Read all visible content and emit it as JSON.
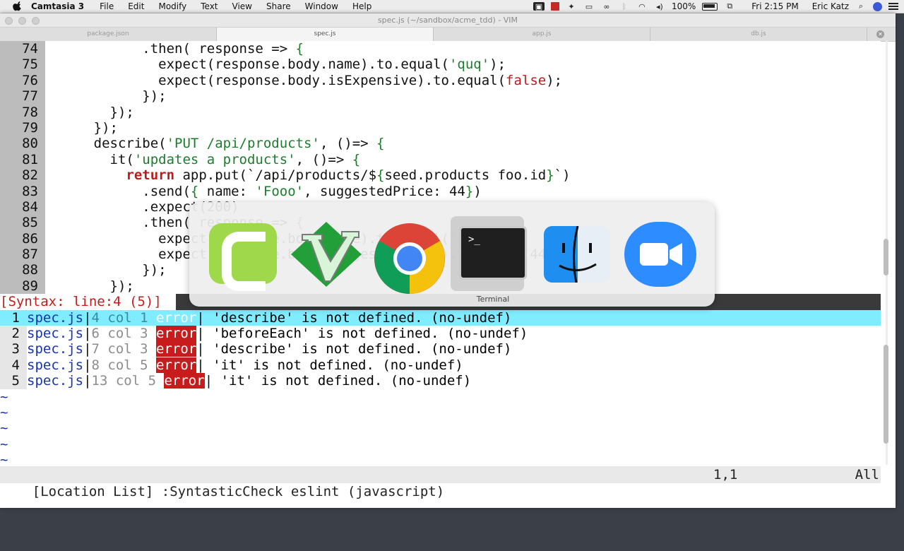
{
  "menubar": {
    "app_name": "Camtasia 3",
    "menus": [
      "File",
      "Edit",
      "Modify",
      "Text",
      "View",
      "Share",
      "Window",
      "Help"
    ],
    "battery": "100%",
    "clock": "Fri 2:15 PM",
    "user": "Eric Katz"
  },
  "window": {
    "title": "spec.js (~/sandbox/acme_tdd) - VIM",
    "tabs": [
      "package.json",
      "spec.js",
      "app.js",
      "db.js"
    ],
    "active_tab": "spec.js"
  },
  "editor": {
    "lines": [
      {
        "n": "74",
        "segments": [
          [
            "            .then( response => ",
            ""
          ],
          [
            "{",
            "punc"
          ]
        ]
      },
      {
        "n": "75",
        "segments": [
          [
            "              expect(response.body.name).to.equal(",
            ""
          ],
          [
            "'quq'",
            "str"
          ],
          [
            ");",
            ""
          ]
        ]
      },
      {
        "n": "76",
        "segments": [
          [
            "              expect(response.body.isExpensive).to.equal(",
            ""
          ],
          [
            "false",
            "bool"
          ],
          [
            ");",
            ""
          ]
        ]
      },
      {
        "n": "77",
        "segments": [
          [
            "            });",
            ""
          ]
        ]
      },
      {
        "n": "78",
        "segments": [
          [
            "        });",
            ""
          ]
        ]
      },
      {
        "n": "79",
        "segments": [
          [
            "      });",
            ""
          ]
        ]
      },
      {
        "n": "80",
        "segments": [
          [
            "      describe(",
            ""
          ],
          [
            "'PUT /api/products'",
            "str"
          ],
          [
            ", ()=> ",
            ""
          ],
          [
            "{",
            "punc"
          ]
        ]
      },
      {
        "n": "81",
        "segments": [
          [
            "        it(",
            ""
          ],
          [
            "'updates a products'",
            "str"
          ],
          [
            ", ()=> ",
            ""
          ],
          [
            "{",
            "punc"
          ]
        ]
      },
      {
        "n": "82",
        "segments": [
          [
            "          ",
            ""
          ],
          [
            "return",
            "kw"
          ],
          [
            " app.put(`/api/products/$",
            ""
          ],
          [
            "{",
            "punc"
          ],
          [
            "seed.products foo.id",
            ""
          ],
          [
            "}",
            "punc"
          ],
          [
            "`)",
            ""
          ]
        ]
      },
      {
        "n": "83",
        "segments": [
          [
            "            .send(",
            ""
          ],
          [
            "{",
            "punc"
          ],
          [
            " name: ",
            ""
          ],
          [
            "'Fooo'",
            "str"
          ],
          [
            ", suggestedPrice: 44",
            ""
          ],
          [
            "}",
            "punc"
          ],
          [
            ")",
            ""
          ]
        ]
      },
      {
        "n": "84",
        "segments": [
          [
            "            .expect(200)",
            ""
          ]
        ]
      },
      {
        "n": "85",
        "segments": [
          [
            "            .then( response => ",
            ""
          ],
          [
            "{",
            "punc"
          ]
        ]
      },
      {
        "n": "86",
        "segments": [
          [
            "              expect(response.body.name).to.equal(",
            ""
          ],
          [
            "'Fooo'",
            "str"
          ],
          [
            ");",
            ""
          ]
        ]
      },
      {
        "n": "87",
        "segments": [
          [
            "              expect(response.body.suggestedPrice).to.equal(44);",
            ""
          ]
        ]
      },
      {
        "n": "88",
        "segments": [
          [
            "            });",
            ""
          ]
        ]
      },
      {
        "n": "89",
        "segments": [
          [
            "        });",
            ""
          ]
        ]
      }
    ],
    "syntax_status": "[Syntax: line:4 (5)]"
  },
  "location_list": [
    {
      "n": "1",
      "file": "spec.js",
      "pos": "4 col 1 ",
      "type": "error",
      "msg": " 'describe' is not defined. (no-undef)",
      "selected": true
    },
    {
      "n": "2",
      "file": "spec.js",
      "pos": "6 col 3 ",
      "type": "error",
      "msg": " 'beforeEach' is not defined. (no-undef)",
      "selected": false
    },
    {
      "n": "3",
      "file": "spec.js",
      "pos": "7 col 3 ",
      "type": "error",
      "msg": " 'describe' is not defined. (no-undef)",
      "selected": false
    },
    {
      "n": "4",
      "file": "spec.js",
      "pos": "8 col 5 ",
      "type": "error",
      "msg": " 'it' is not defined. (no-undef)",
      "selected": false
    },
    {
      "n": "5",
      "file": "spec.js",
      "pos": "13 col 5 ",
      "type": "error",
      "msg": " 'it' is not defined. (no-undef)",
      "selected": false
    }
  ],
  "empty_line_marker": "~",
  "statusline": {
    "left": "[Location List] :SyntasticCheck eslint (javascript)",
    "position": "1,1",
    "scroll": "All"
  },
  "app_switcher": {
    "apps": [
      "Camtasia",
      "MacVim",
      "Google Chrome",
      "Terminal",
      "Finder",
      "Zoom"
    ],
    "selected_label": "Terminal",
    "terminal_prompt": ">_"
  }
}
